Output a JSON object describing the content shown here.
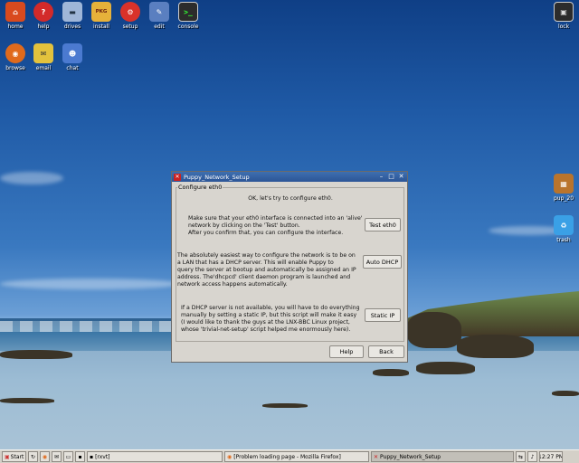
{
  "desktop": {
    "icons_row1": [
      {
        "label": "home",
        "icon": "home-icon",
        "color": "#d94a1e",
        "glyph": "⌂"
      },
      {
        "label": "help",
        "icon": "help-icon",
        "color": "#d32a2a",
        "glyph": "?"
      },
      {
        "label": "drives",
        "icon": "drives-icon",
        "color": "#9fb6d8",
        "glyph": "▬"
      },
      {
        "label": "install",
        "icon": "install-icon",
        "color": "#e6b13a",
        "glyph": "PKG"
      },
      {
        "label": "setup",
        "icon": "setup-icon",
        "color": "#d9322a",
        "glyph": "⚙"
      },
      {
        "label": "edit",
        "icon": "edit-icon",
        "color": "#5a7fc0",
        "glyph": "✎"
      },
      {
        "label": "console",
        "icon": "console-icon",
        "color": "#2c2c2c",
        "glyph": ">_"
      }
    ],
    "icons_row2": [
      {
        "label": "browse",
        "icon": "browse-icon",
        "color": "#e06a1c",
        "glyph": "◉"
      },
      {
        "label": "email",
        "icon": "email-icon",
        "color": "#e3c23d",
        "glyph": "✉"
      },
      {
        "label": "chat",
        "icon": "chat-icon",
        "color": "#4b7ad0",
        "glyph": "☻"
      }
    ],
    "right_icons": [
      {
        "label": "lock",
        "icon": "lock-icon",
        "color": "#2c2c2c",
        "glyph": "▣"
      },
      {
        "label": "pup_20",
        "icon": "package-icon",
        "color": "#b9742c",
        "glyph": "▦"
      },
      {
        "label": "trash",
        "icon": "trash-icon",
        "color": "#3aa0e6",
        "glyph": "♻"
      }
    ]
  },
  "dialog": {
    "title": "Puppy_Network_Setup",
    "frame_label": "Configure eth0",
    "intro": "OK, let's try to configure eth0.",
    "test_text": [
      "Make sure that your eth0 interface is connected into an 'alive'",
      "network by clicking on the 'Test' button.",
      "After you confirm that, you can configure the interface."
    ],
    "test_button": "Test eth0",
    "dhcp_text": [
      "The absolutely easiest way to configure the network is to be on",
      "a LAN that has a DHCP server. This will enable Puppy to",
      "query the server at bootup and automatically be assigned an IP",
      "address. The'dhcpcd' client daemon program is launched and",
      "network access happens automatically."
    ],
    "dhcp_button": "Auto DHCP",
    "static_text": [
      "If a DHCP server is not available, you will have to do everything",
      "manually by setting a static IP, but this script will make it easy",
      "(I would like to thank the guys at the LNX-BBC Linux project,",
      "whose 'trivial-net-setup' script helped me enormously here)."
    ],
    "static_button": "Static IP",
    "help_button": "Help",
    "back_button": "Back"
  },
  "taskbar": {
    "start_label": "Start",
    "tasks": [
      "[rxvt]",
      "[Problem loading page - Mozilla Firefox]",
      "Puppy_Network_Setup"
    ],
    "clock": "12:27 PM"
  }
}
